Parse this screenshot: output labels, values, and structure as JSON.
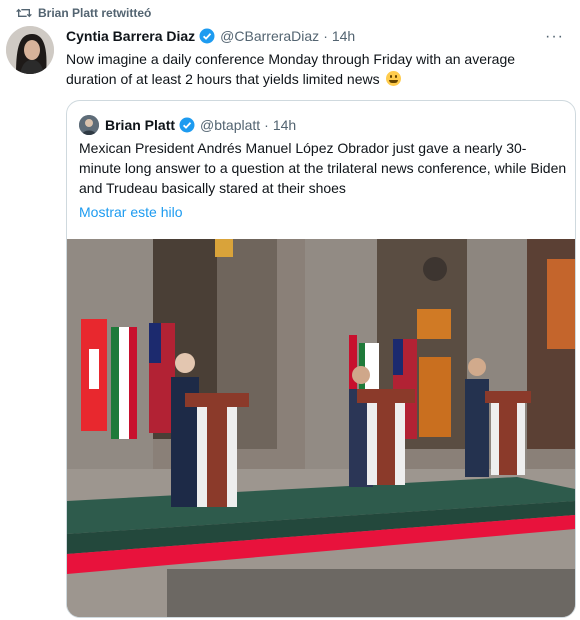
{
  "retweet": {
    "label": "Brian Platt retwitteó"
  },
  "tweet": {
    "author_name": "Cyntia Barrera Diaz",
    "handle": "@CBarreraDiaz",
    "separator": "·",
    "time": "14h",
    "more": "···",
    "text": "Now imagine a daily conference Monday through Friday with an average duration of at least 2 hours that yields limited news"
  },
  "quote": {
    "author_name": "Brian Platt",
    "handle": "@btaplatt",
    "separator": "·",
    "time": "14h",
    "text": "Mexican President Andrés Manuel López Obrador just gave a nearly 30-minute long answer to a question at the trilateral news conference, while Biden and Trudeau basically stared at their shoes",
    "show_thread": "Mostrar este hilo"
  },
  "colors": {
    "accent": "#1d9bf0",
    "secondary_text": "#536471",
    "border": "#cfd9de",
    "carpet_red": "#e8123c",
    "stage_green": "#2e5b4c"
  },
  "icons": {
    "retweet": "retweet-icon",
    "verified": "verified-badge-icon",
    "more": "more-icon",
    "emoji": "grimacing-face-emoji"
  }
}
